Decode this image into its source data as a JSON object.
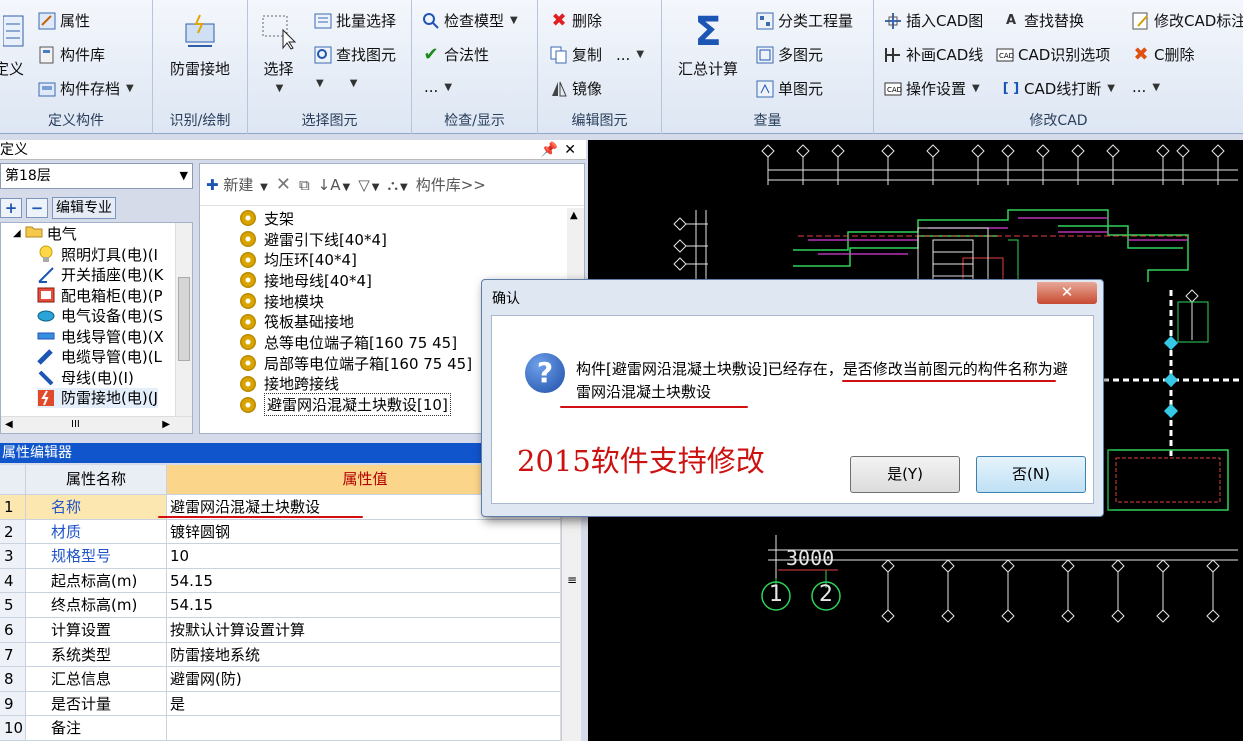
{
  "ribbon": {
    "groups": {
      "define": {
        "label": "定义构件",
        "big_label": "定义",
        "buttons": [
          "属性",
          "构件库",
          "构件存档"
        ]
      },
      "identify": {
        "label": "识别/绘制",
        "big_label": "防雷接地"
      },
      "select": {
        "label": "选择图元",
        "big_label": "选择",
        "buttons": [
          "批量选择",
          "查找图元"
        ]
      },
      "check": {
        "label": "检查/显示",
        "buttons": [
          "检查模型",
          "合法性",
          "..."
        ]
      },
      "edit": {
        "label": "编辑图元",
        "buttons": [
          "删除",
          "复制",
          "...",
          "镜像"
        ]
      },
      "quantity": {
        "label": "查量",
        "big_label": "汇总计算",
        "buttons": [
          "分类工程量",
          "多图元",
          "单图元"
        ]
      },
      "cad": {
        "label": "修改CAD",
        "buttons": [
          "插入CAD图",
          "查找替换",
          "修改CAD标注",
          "补画CAD线",
          "CAD识别选项",
          "C删除",
          "操作设置",
          "CAD线打断",
          "..."
        ]
      }
    }
  },
  "left": {
    "panel_title": "定义",
    "floor": "第18层",
    "edit_spec": "编辑专业",
    "tree_root": "电气",
    "tree_items": [
      "照明灯具(电)(I",
      "开关插座(电)(K",
      "配电箱柜(电)(P",
      "电气设备(电)(S",
      "电线导管(电)(X",
      "电缆导管(电)(L",
      "母线(电)(I)",
      "防雷接地(电)(J"
    ],
    "tree_scroll_marker": "III"
  },
  "components": {
    "toolbar": {
      "new": "新建",
      "library": "构件库>>"
    },
    "items": [
      "支架",
      "避雷引下线[40*4]",
      "均压环[40*4]",
      "接地母线[40*4]",
      "接地模块",
      "筏板基础接地",
      "总等电位端子箱[160 75 45]",
      "局部等电位端子箱[160 75 45]",
      "接地跨接线",
      "避雷网沿混凝土块敷设[10]"
    ]
  },
  "properties": {
    "title": "属性编辑器",
    "header": {
      "name": "属性名称",
      "value": "属性值"
    },
    "rows": [
      {
        "n": "1",
        "k": "名称",
        "v": "避雷网沿混凝土块敷设"
      },
      {
        "n": "2",
        "k": "材质",
        "v": "镀锌圆钢"
      },
      {
        "n": "3",
        "k": "规格型号",
        "v": "10"
      },
      {
        "n": "4",
        "k": "起点标高(m)",
        "v": "54.15"
      },
      {
        "n": "5",
        "k": "终点标高(m)",
        "v": "54.15"
      },
      {
        "n": "6",
        "k": "计算设置",
        "v": "按默认计算设置计算"
      },
      {
        "n": "7",
        "k": "系统类型",
        "v": "防雷接地系统"
      },
      {
        "n": "8",
        "k": "汇总信息",
        "v": "避雷网(防)"
      },
      {
        "n": "9",
        "k": "是否计量",
        "v": "是"
      },
      {
        "n": "10",
        "k": "备注",
        "v": ""
      }
    ]
  },
  "cad": {
    "dimension": "3000",
    "axis_labels": [
      "1",
      "2"
    ]
  },
  "dialog": {
    "title": "确认",
    "message": "构件[避雷网沿混凝土块敷设]已经存在，是否修改当前图元的构件名称为避雷网沿混凝土块敷设",
    "yes": "是(Y)",
    "no": "否(N)",
    "annotation": "2015软件支持修改"
  },
  "colors": {
    "annotation_red": "#cc1111",
    "title_blue": "#1155cc",
    "cad_bg": "#000000"
  }
}
